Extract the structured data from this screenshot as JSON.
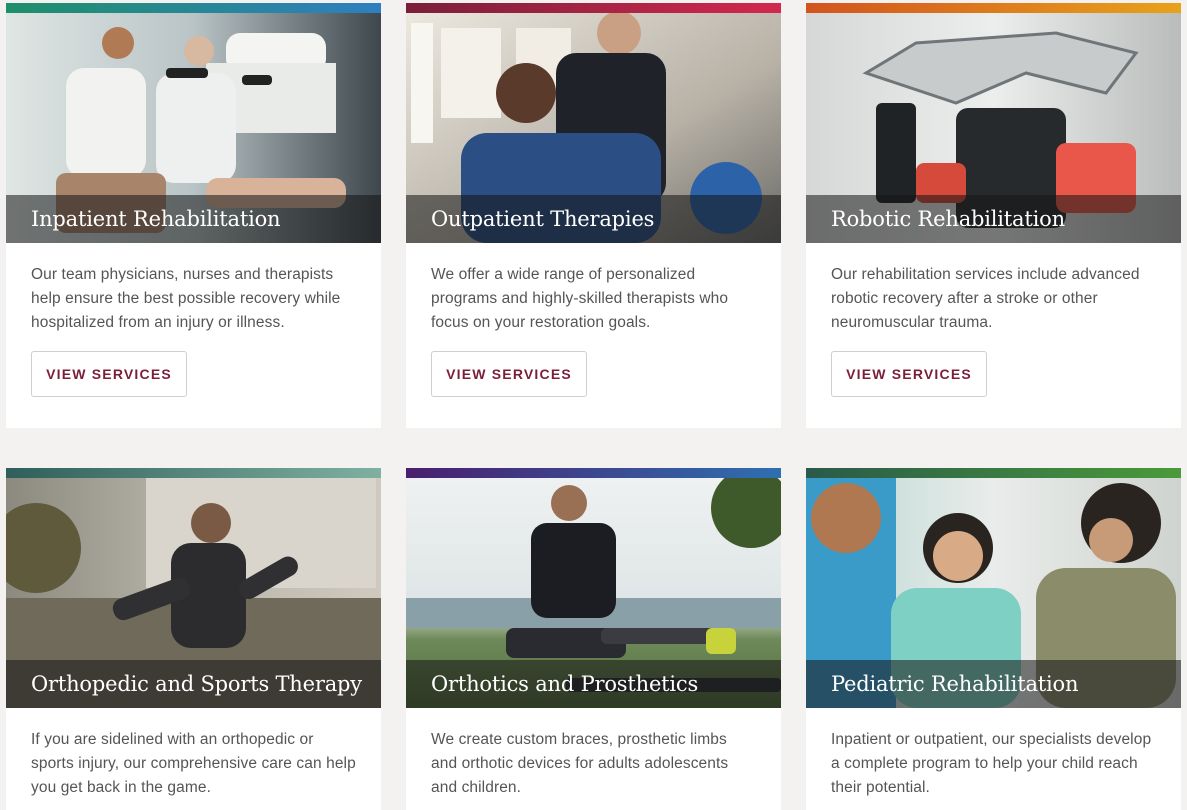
{
  "cards": [
    {
      "title": "Inpatient Rehabilitation",
      "description": "Our team physicians, nurses and therapists help ensure the best possible recovery while hospitalized from an injury or illness.",
      "button": "VIEW SERVICES",
      "accent": "#1f8f6a",
      "accent_end": "#2f7fc0"
    },
    {
      "title": "Outpatient Therapies",
      "description": "We offer a wide range of personalized programs and highly-skilled therapists who focus on your restoration goals.",
      "button": "VIEW SERVICES",
      "accent": "#7a1f3a",
      "accent_end": "#d3284e"
    },
    {
      "title": "Robotic Rehabilitation",
      "description": "Our rehabilitation services include advanced robotic recovery after a stroke or other neuromuscular trauma.",
      "button": "VIEW SERVICES",
      "accent": "#d2541e",
      "accent_end": "#e8a21b"
    },
    {
      "title": "Orthopedic and Sports Therapy",
      "description": "If you are sidelined with an orthopedic or sports injury, our comprehensive care can help you get back in the game.",
      "accent": "#2f5f5a",
      "accent_end": "#7fb0a0"
    },
    {
      "title": "Orthotics and Prosthetics",
      "description": "We create custom braces, prosthetic limbs and orthotic devices for adults adolescents and children.",
      "accent": "#4a1f6e",
      "accent_end": "#2f6fb0"
    },
    {
      "title": "Pediatric Rehabilitation",
      "description": "Inpatient or outpatient, our specialists develop a complete program to help your child reach their potential.",
      "accent": "#2a5a4a",
      "accent_end": "#4a9a3a"
    }
  ]
}
